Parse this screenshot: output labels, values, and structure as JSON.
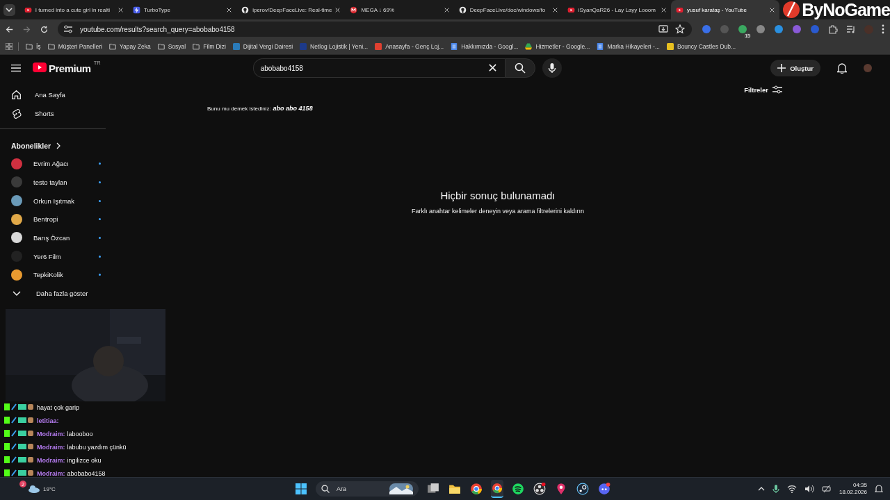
{
  "browser": {
    "tabs": [
      {
        "title": "I turned into a cute girl in realti",
        "kind": "youtube",
        "selected": false
      },
      {
        "title": "TurboType",
        "kind": "turbotype",
        "selected": false
      },
      {
        "title": "iperov/DeepFaceLive: Real-time",
        "kind": "github",
        "selected": false
      },
      {
        "title": "MEGA ↓ 69%",
        "kind": "mega",
        "selected": false
      },
      {
        "title": "DeepFaceLive/doc/windows/fo",
        "kind": "github",
        "selected": false
      },
      {
        "title": "iSyanQaR26 - Lay Layy Looom",
        "kind": "youtube",
        "selected": false
      },
      {
        "title": "yusuf karataş - YouTube",
        "kind": "youtube",
        "selected": true
      }
    ],
    "overlay_logo": "ByNoGame",
    "address": "youtube.com/results?search_query=abobabo4158",
    "extension_badge": "15",
    "bookmarks": [
      {
        "label": "İş",
        "kind": "folder"
      },
      {
        "label": "Müşteri Panelleri",
        "kind": "folder"
      },
      {
        "label": "Yapay Zeka",
        "kind": "folder"
      },
      {
        "label": "Sosyal",
        "kind": "folder"
      },
      {
        "label": "Film Dizi",
        "kind": "folder"
      },
      {
        "label": "Dijital Vergi Dairesi",
        "kind": "site",
        "color": "#2a7ab8"
      },
      {
        "label": "Netlog Lojistik | Yeni...",
        "kind": "site",
        "color": "#1d3a8a"
      },
      {
        "label": "Anasayfa - Genç Loj...",
        "kind": "site",
        "color": "#e04030"
      },
      {
        "label": "Hakkımızda - Googl...",
        "kind": "doc",
        "color": "#4a86e8"
      },
      {
        "label": "Hizmetler - Google...",
        "kind": "drive",
        "color": "#34a853"
      },
      {
        "label": "Marka Hikayeleri -...",
        "kind": "doc",
        "color": "#4a86e8"
      },
      {
        "label": "Bouncy Castles Dub...",
        "kind": "site",
        "color": "#e8c020"
      }
    ]
  },
  "youtube": {
    "logo": "Premium",
    "region": "TR",
    "search": {
      "value": "abobabo4158"
    },
    "create_button": "Oluştur",
    "sidebar": {
      "items": [
        {
          "label": "Ana Sayfa",
          "kind": "home"
        },
        {
          "label": "Shorts",
          "kind": "shorts"
        }
      ],
      "subscriptions_title": "Abonelikler",
      "subscriptions": [
        {
          "name": "Evrim Ağacı",
          "color": "#d03040",
          "new": true
        },
        {
          "name": "testo taylan",
          "color": "#3a3a3a",
          "new": true
        },
        {
          "name": "Orkun Işıtmak",
          "color": "#6a9ab8",
          "new": true
        },
        {
          "name": "Bentropi",
          "color": "#e0a848",
          "new": true
        },
        {
          "name": "Barış Özcan",
          "color": "#d8d8d8",
          "new": true
        },
        {
          "name": "Yer6 Film",
          "color": "#222222",
          "new": true
        },
        {
          "name": "TepkiKolik",
          "color": "#e89a30",
          "new": true
        }
      ],
      "show_more": "Daha fazla göster"
    },
    "filters": "Filtreler",
    "suggestion": {
      "label": "Bunu mu demek istediniz:",
      "query": "abo abo 4158"
    },
    "empty": {
      "title": "Hiçbir sonuç bulunamadı",
      "hint": "Farklı anahtar kelimeler deneyin veya arama filtrelerini kaldırın"
    }
  },
  "stream_chat": [
    {
      "text": "hayat çok garip"
    },
    {
      "user": "letitiaa:"
    },
    {
      "user": "Modraim:",
      "text": "labooboo"
    },
    {
      "user": "Modraim:",
      "text": "labubu yazdım çünkü"
    },
    {
      "user": "Modraim:",
      "text": "ingilizce oku"
    },
    {
      "user": "Modraim:",
      "text": "abobabo4158"
    }
  ],
  "taskbar": {
    "weather": "19°C",
    "weather_badge": "2",
    "search": "Ara",
    "apps": [
      {
        "kind": "files"
      },
      {
        "kind": "folder"
      },
      {
        "kind": "chrome"
      },
      {
        "kind": "chrome"
      },
      {
        "kind": "spotify"
      },
      {
        "kind": "obs"
      },
      {
        "kind": "maps"
      },
      {
        "kind": "steam"
      },
      {
        "kind": "discord"
      }
    ],
    "time": "04:35",
    "date": "18.02.2026"
  }
}
